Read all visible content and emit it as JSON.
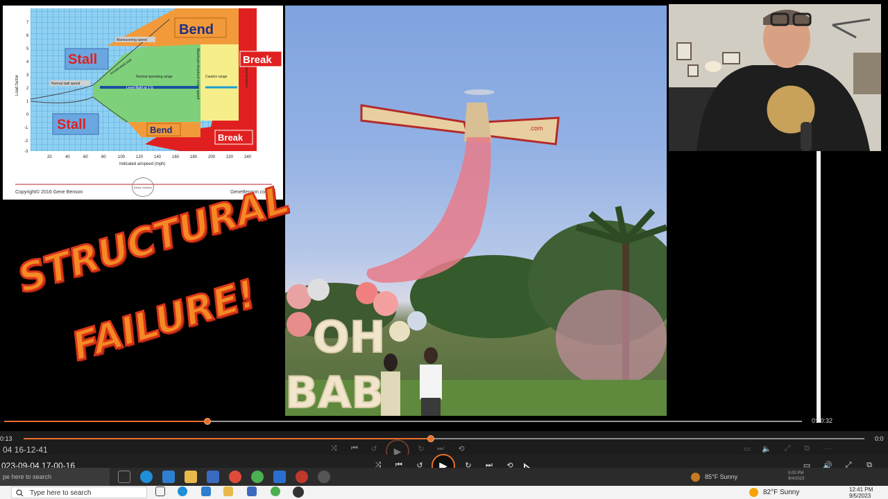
{
  "overlay": {
    "line1": "STRUCTURAL",
    "line2": "FAILURE!"
  },
  "chart": {
    "labels": {
      "bend_top": "Bend",
      "bend_bottom": "Bend",
      "stall_top": "Stall",
      "stall_bottom": "Stall",
      "break_top": "Break",
      "break_bottom": "Break",
      "maneuvering_speed": "Maneuvering speed",
      "normal_operating_range": "Normal operating range",
      "caution_range": "Caution range",
      "level_flight": "Level flight at 1 G",
      "normal_stall_speed": "Normal stall speed",
      "accelerated_stall": "Accelerated stall",
      "max_structural_cruise": "Maximum structural cruise speed",
      "never_exceed": "Never exceed speed",
      "y_axis": "Load factor",
      "x_axis": "Indicated airspeed (mph)"
    },
    "y_ticks": [
      "7",
      "6",
      "5",
      "4",
      "3",
      "2",
      "1",
      "0",
      "-1",
      "-2",
      "-3"
    ],
    "x_ticks": [
      "20",
      "40",
      "60",
      "80",
      "100",
      "120",
      "140",
      "160",
      "180",
      "200",
      "220",
      "240"
    ],
    "copyright": "Copyright© 2016 Gene Benson",
    "site": "GeneBenson.com",
    "logo_text": "Safety Initiative"
  },
  "video": {
    "plane_text": ".com",
    "sign_letters": [
      "OH",
      "BAB"
    ]
  },
  "player1": {
    "time": "0:00:32",
    "progress": 0.255
  },
  "player2": {
    "elapsed": "0:13",
    "total": "0:0",
    "title": "04 16-12-41",
    "progress": 0.484,
    "controls": {
      "shuffle": "⤨",
      "prev": "⏮",
      "back": "↺",
      "play": "▶",
      "forward": "↻",
      "next": "⏭",
      "repeat": "⟲",
      "captions": "▭",
      "volume": "🔈",
      "fullscreen": "⤢",
      "miniplayer": "⧉",
      "more": "⋯"
    }
  },
  "player3": {
    "title": "023-09-04 17-00-16",
    "controls": {
      "shuffle": "⤨",
      "prev": "⏮",
      "back": "↺",
      "play": "▶",
      "forward": "↻",
      "next": "⏭",
      "repeat": "⟲",
      "captions": "▭",
      "volume": "🔊",
      "fullscreen": "⤢",
      "miniplayer": "⧉"
    }
  },
  "taskbar1": {
    "search_placeholder": "pe here to search",
    "weather": "85°F  Sunny",
    "time": "5:00 PM",
    "date": "9/4/2023"
  },
  "taskbar2": {
    "search_placeholder": "Type here to search",
    "weather": "82°F  Sunny",
    "time": "12:41 PM",
    "date": "9/5/2023"
  },
  "colors": {
    "accent": "#e8702a",
    "title_fill": "#f58a24",
    "title_stroke": "#d9341a"
  }
}
